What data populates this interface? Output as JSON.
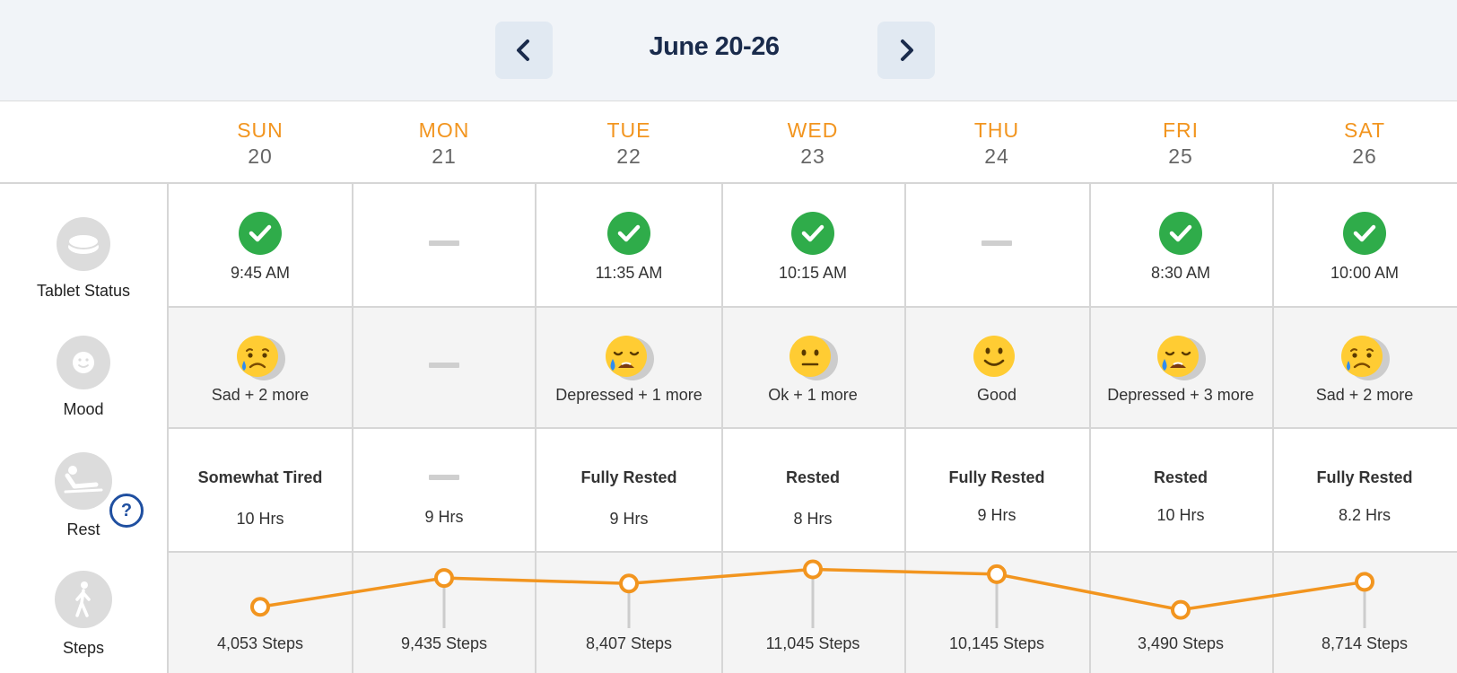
{
  "header": {
    "week_title": "June 20-26",
    "prev_icon": "chevron-left-icon",
    "next_icon": "chevron-right-icon"
  },
  "colors": {
    "accent": "#f2951f",
    "check": "#2fac4a",
    "title": "#1a2b4c",
    "help": "#1f4fa0"
  },
  "rows": {
    "tablet": {
      "label": "Tablet Status",
      "icon": "pill-icon"
    },
    "mood": {
      "label": "Mood",
      "icon": "smiley-icon"
    },
    "rest": {
      "label": "Rest",
      "icon": "recline-icon",
      "help_text": "?"
    },
    "steps": {
      "label": "Steps",
      "icon": "walking-icon"
    }
  },
  "days": [
    {
      "name": "SUN",
      "num": "20",
      "tablet": {
        "taken": true,
        "time": "9:45 AM"
      },
      "mood": {
        "emoji": "sad",
        "text": "Sad + 2 more"
      },
      "rest": {
        "quality": "Somewhat Tired",
        "hours": "10 Hrs"
      },
      "steps": {
        "value": 4053,
        "label": "4,053 Steps"
      }
    },
    {
      "name": "MON",
      "num": "21",
      "tablet": {
        "taken": false,
        "time": ""
      },
      "mood": {
        "emoji": "none",
        "text": ""
      },
      "rest": {
        "quality": "",
        "hours": "9 Hrs"
      },
      "steps": {
        "value": 9435,
        "label": "9,435 Steps"
      }
    },
    {
      "name": "TUE",
      "num": "22",
      "tablet": {
        "taken": true,
        "time": "11:35 AM"
      },
      "mood": {
        "emoji": "depressed",
        "text": "Depressed + 1 more"
      },
      "rest": {
        "quality": "Fully Rested",
        "hours": "9 Hrs"
      },
      "steps": {
        "value": 8407,
        "label": "8,407 Steps"
      }
    },
    {
      "name": "WED",
      "num": "23",
      "tablet": {
        "taken": true,
        "time": "10:15 AM"
      },
      "mood": {
        "emoji": "ok",
        "text": "Ok + 1 more"
      },
      "rest": {
        "quality": "Rested",
        "hours": "8 Hrs"
      },
      "steps": {
        "value": 11045,
        "label": "11,045 Steps"
      }
    },
    {
      "name": "THU",
      "num": "24",
      "tablet": {
        "taken": false,
        "time": ""
      },
      "mood": {
        "emoji": "good",
        "text": "Good"
      },
      "rest": {
        "quality": "Fully Rested",
        "hours": "9 Hrs"
      },
      "steps": {
        "value": 10145,
        "label": "10,145 Steps"
      }
    },
    {
      "name": "FRI",
      "num": "25",
      "tablet": {
        "taken": true,
        "time": "8:30 AM"
      },
      "mood": {
        "emoji": "depressed",
        "text": "Depressed + 3 more"
      },
      "rest": {
        "quality": "Rested",
        "hours": "10 Hrs"
      },
      "steps": {
        "value": 3490,
        "label": "3,490 Steps"
      }
    },
    {
      "name": "SAT",
      "num": "26",
      "tablet": {
        "taken": true,
        "time": "10:00 AM"
      },
      "mood": {
        "emoji": "sad",
        "text": "Sad + 2 more"
      },
      "rest": {
        "quality": "Fully Rested",
        "hours": "8.2 Hrs"
      },
      "steps": {
        "value": 8714,
        "label": "8,714 Steps"
      }
    }
  ]
}
